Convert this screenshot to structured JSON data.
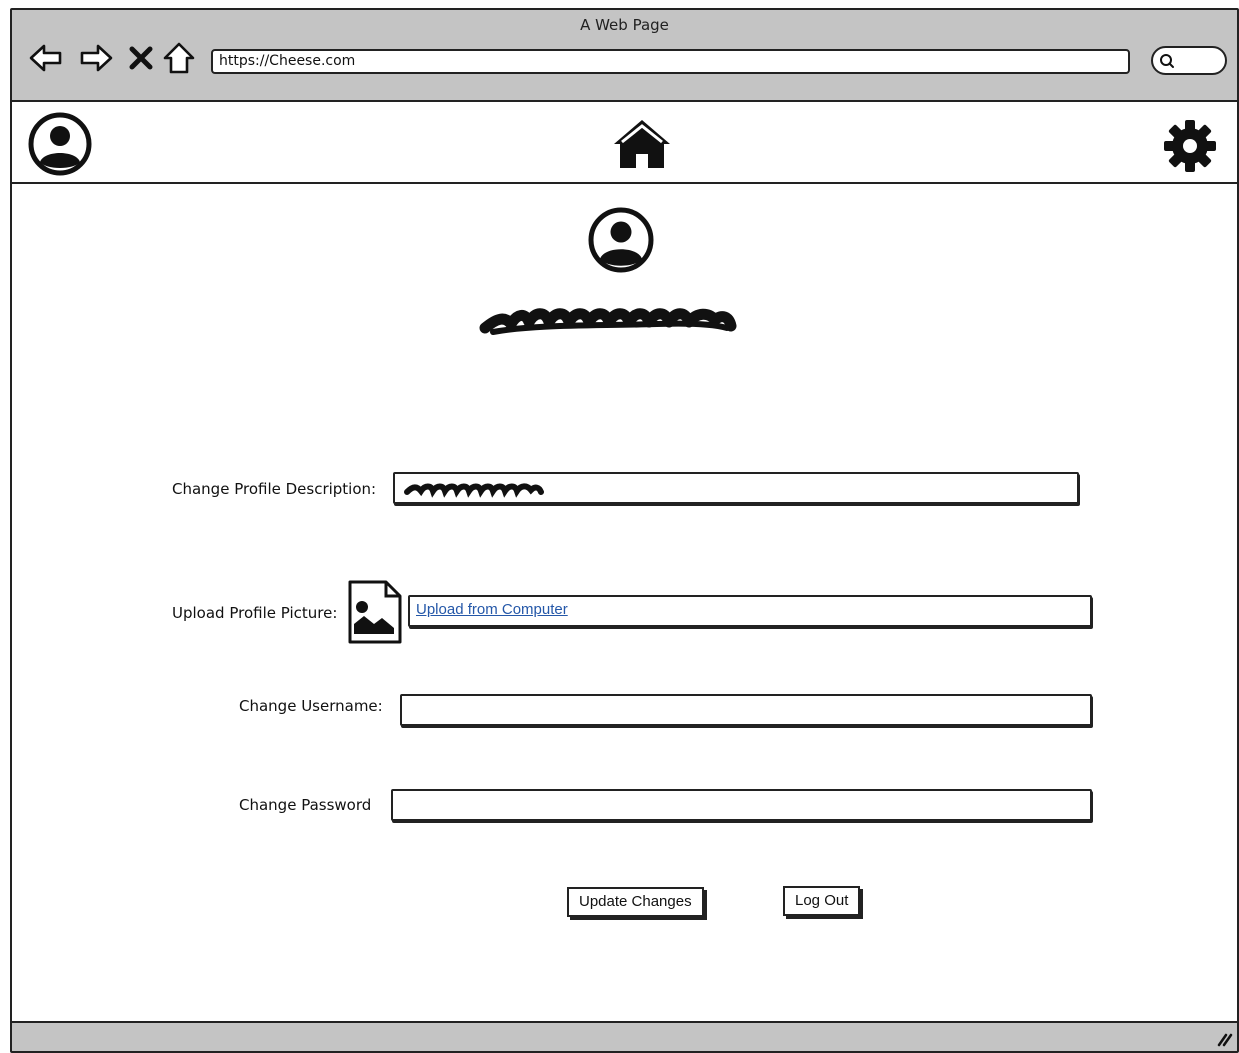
{
  "browser": {
    "window_title": "A Web Page",
    "url": "https://Cheese.com"
  },
  "header": {
    "left_icon": "user-circle-icon",
    "center_icon": "home-icon",
    "right_icon": "gear-icon"
  },
  "profile": {
    "avatar_icon": "user-circle-icon"
  },
  "form": {
    "description_label": "Change Profile Description:",
    "picture_label": "Upload Profile Picture:",
    "upload_link": "Upload from Computer",
    "username_label": "Change Username:",
    "username_value": "",
    "password_label": "Change Password",
    "password_value": ""
  },
  "actions": {
    "update_label": "Update Changes",
    "logout_label": "Log Out"
  },
  "colors": {
    "chrome": "#c4c4c4",
    "link": "#2457a8",
    "ink": "#222222"
  }
}
